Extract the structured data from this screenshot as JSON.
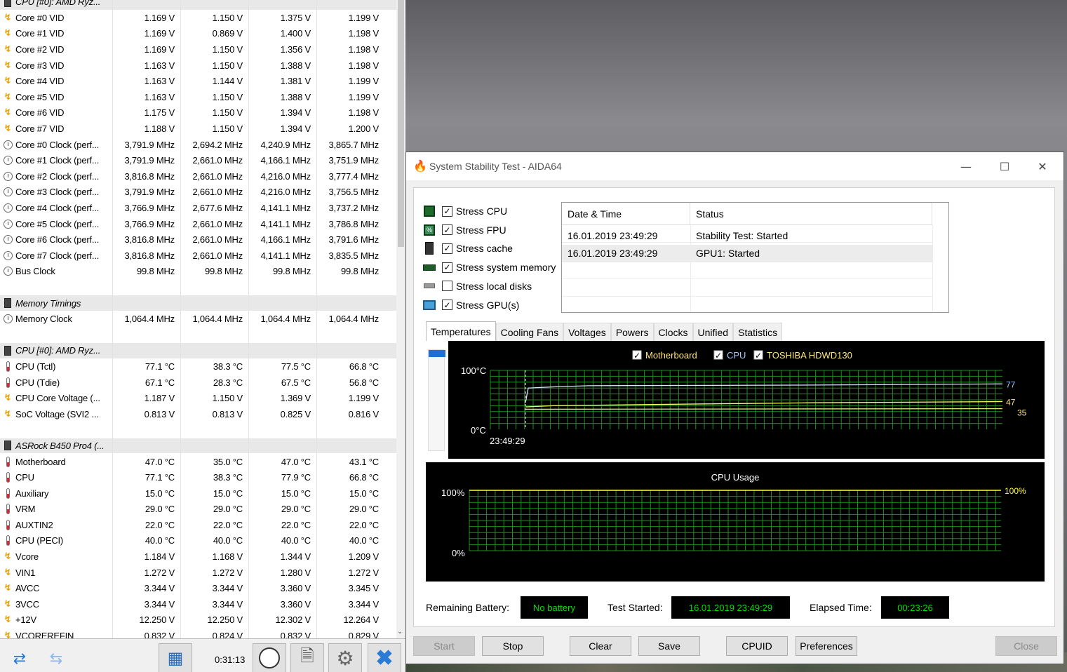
{
  "hwinfo": {
    "rows": [
      {
        "type": "group",
        "icon": "chip",
        "name": "CPU [#0]: AMD Ryz...",
        "v": [
          "",
          "",
          "",
          ""
        ]
      },
      {
        "type": "row",
        "icon": "bolt",
        "name": "Core #0 VID",
        "v": [
          "1.169 V",
          "1.150 V",
          "1.375 V",
          "1.199 V"
        ]
      },
      {
        "type": "row",
        "icon": "bolt",
        "name": "Core #1 VID",
        "v": [
          "1.169 V",
          "0.869 V",
          "1.400 V",
          "1.198 V"
        ]
      },
      {
        "type": "row",
        "icon": "bolt",
        "name": "Core #2 VID",
        "v": [
          "1.169 V",
          "1.150 V",
          "1.356 V",
          "1.198 V"
        ]
      },
      {
        "type": "row",
        "icon": "bolt",
        "name": "Core #3 VID",
        "v": [
          "1.163 V",
          "1.150 V",
          "1.388 V",
          "1.198 V"
        ]
      },
      {
        "type": "row",
        "icon": "bolt",
        "name": "Core #4 VID",
        "v": [
          "1.163 V",
          "1.144 V",
          "1.381 V",
          "1.199 V"
        ]
      },
      {
        "type": "row",
        "icon": "bolt",
        "name": "Core #5 VID",
        "v": [
          "1.163 V",
          "1.150 V",
          "1.388 V",
          "1.199 V"
        ]
      },
      {
        "type": "row",
        "icon": "bolt",
        "name": "Core #6 VID",
        "v": [
          "1.175 V",
          "1.150 V",
          "1.394 V",
          "1.198 V"
        ]
      },
      {
        "type": "row",
        "icon": "bolt",
        "name": "Core #7 VID",
        "v": [
          "1.188 V",
          "1.150 V",
          "1.394 V",
          "1.200 V"
        ]
      },
      {
        "type": "row",
        "icon": "clock",
        "name": "Core #0 Clock (perf...",
        "v": [
          "3,791.9 MHz",
          "2,694.2 MHz",
          "4,240.9 MHz",
          "3,865.7 MHz"
        ]
      },
      {
        "type": "row",
        "icon": "clock",
        "name": "Core #1 Clock (perf...",
        "v": [
          "3,791.9 MHz",
          "2,661.0 MHz",
          "4,166.1 MHz",
          "3,751.9 MHz"
        ]
      },
      {
        "type": "row",
        "icon": "clock",
        "name": "Core #2 Clock (perf...",
        "v": [
          "3,816.8 MHz",
          "2,661.0 MHz",
          "4,216.0 MHz",
          "3,777.4 MHz"
        ]
      },
      {
        "type": "row",
        "icon": "clock",
        "name": "Core #3 Clock (perf...",
        "v": [
          "3,791.9 MHz",
          "2,661.0 MHz",
          "4,216.0 MHz",
          "3,756.5 MHz"
        ]
      },
      {
        "type": "row",
        "icon": "clock",
        "name": "Core #4 Clock (perf...",
        "v": [
          "3,766.9 MHz",
          "2,677.6 MHz",
          "4,141.1 MHz",
          "3,737.2 MHz"
        ]
      },
      {
        "type": "row",
        "icon": "clock",
        "name": "Core #5 Clock (perf...",
        "v": [
          "3,766.9 MHz",
          "2,661.0 MHz",
          "4,141.1 MHz",
          "3,786.8 MHz"
        ]
      },
      {
        "type": "row",
        "icon": "clock",
        "name": "Core #6 Clock (perf...",
        "v": [
          "3,816.8 MHz",
          "2,661.0 MHz",
          "4,166.1 MHz",
          "3,791.6 MHz"
        ]
      },
      {
        "type": "row",
        "icon": "clock",
        "name": "Core #7 Clock (perf...",
        "v": [
          "3,816.8 MHz",
          "2,661.0 MHz",
          "4,141.1 MHz",
          "3,835.5 MHz"
        ]
      },
      {
        "type": "row",
        "icon": "clock",
        "name": "Bus Clock",
        "v": [
          "99.8 MHz",
          "99.8 MHz",
          "99.8 MHz",
          "99.8 MHz"
        ]
      },
      {
        "type": "blank",
        "icon": "",
        "name": "",
        "v": [
          "",
          "",
          "",
          ""
        ]
      },
      {
        "type": "group",
        "icon": "chip",
        "name": "Memory Timings",
        "v": [
          "",
          "",
          "",
          ""
        ]
      },
      {
        "type": "row",
        "icon": "clock",
        "name": "Memory Clock",
        "v": [
          "1,064.4 MHz",
          "1,064.4 MHz",
          "1,064.4 MHz",
          "1,064.4 MHz"
        ]
      },
      {
        "type": "blank",
        "icon": "",
        "name": "",
        "v": [
          "",
          "",
          "",
          ""
        ]
      },
      {
        "type": "group",
        "icon": "chip",
        "name": "CPU [#0]: AMD Ryz...",
        "v": [
          "",
          "",
          "",
          ""
        ]
      },
      {
        "type": "row",
        "icon": "therm",
        "name": "CPU (Tctl)",
        "v": [
          "77.1 °C",
          "38.3 °C",
          "77.5 °C",
          "66.8 °C"
        ]
      },
      {
        "type": "row",
        "icon": "therm",
        "name": "CPU (Tdie)",
        "v": [
          "67.1 °C",
          "28.3 °C",
          "67.5 °C",
          "56.8 °C"
        ]
      },
      {
        "type": "row",
        "icon": "bolt",
        "name": "CPU Core Voltage (...",
        "v": [
          "1.187 V",
          "1.150 V",
          "1.369 V",
          "1.199 V"
        ]
      },
      {
        "type": "row",
        "icon": "bolt",
        "name": "SoC Voltage (SVI2 ...",
        "v": [
          "0.813 V",
          "0.813 V",
          "0.825 V",
          "0.816 V"
        ]
      },
      {
        "type": "blank",
        "icon": "",
        "name": "",
        "v": [
          "",
          "",
          "",
          ""
        ]
      },
      {
        "type": "group",
        "icon": "chip",
        "name": "ASRock B450 Pro4 (...",
        "v": [
          "",
          "",
          "",
          ""
        ]
      },
      {
        "type": "row",
        "icon": "therm",
        "name": "Motherboard",
        "v": [
          "47.0 °C",
          "35.0 °C",
          "47.0 °C",
          "43.1 °C"
        ]
      },
      {
        "type": "row",
        "icon": "therm",
        "name": "CPU",
        "v": [
          "77.1 °C",
          "38.3 °C",
          "77.9 °C",
          "66.8 °C"
        ]
      },
      {
        "type": "row",
        "icon": "therm",
        "name": "Auxiliary",
        "v": [
          "15.0 °C",
          "15.0 °C",
          "15.0 °C",
          "15.0 °C"
        ]
      },
      {
        "type": "row",
        "icon": "therm",
        "name": "VRM",
        "v": [
          "29.0 °C",
          "29.0 °C",
          "29.0 °C",
          "29.0 °C"
        ]
      },
      {
        "type": "row",
        "icon": "therm",
        "name": "AUXTIN2",
        "v": [
          "22.0 °C",
          "22.0 °C",
          "22.0 °C",
          "22.0 °C"
        ]
      },
      {
        "type": "row",
        "icon": "therm",
        "name": "CPU (PECI)",
        "v": [
          "40.0 °C",
          "40.0 °C",
          "40.0 °C",
          "40.0 °C"
        ]
      },
      {
        "type": "row",
        "icon": "bolt",
        "name": "Vcore",
        "v": [
          "1.184 V",
          "1.168 V",
          "1.344 V",
          "1.209 V"
        ]
      },
      {
        "type": "row",
        "icon": "bolt",
        "name": "VIN1",
        "v": [
          "1.272 V",
          "1.272 V",
          "1.280 V",
          "1.272 V"
        ]
      },
      {
        "type": "row",
        "icon": "bolt",
        "name": "AVCC",
        "v": [
          "3.344 V",
          "3.344 V",
          "3.360 V",
          "3.345 V"
        ]
      },
      {
        "type": "row",
        "icon": "bolt",
        "name": "3VCC",
        "v": [
          "3.344 V",
          "3.344 V",
          "3.360 V",
          "3.344 V"
        ]
      },
      {
        "type": "row",
        "icon": "bolt",
        "name": "+12V",
        "v": [
          "12.250 V",
          "12.250 V",
          "12.302 V",
          "12.264 V"
        ]
      },
      {
        "type": "row",
        "icon": "bolt",
        "name": "VCOREREFIN",
        "v": [
          "0.832 V",
          "0.824 V",
          "0.832 V",
          "0.829 V"
        ]
      }
    ],
    "toolbar": {
      "timer": "0:31:13",
      "icons": [
        "nav-arrows-icon",
        "nav-arrows-disabled-icon",
        "network-icon",
        "clock-icon",
        "report-icon",
        "settings-icon",
        "close-x-icon"
      ]
    }
  },
  "aida": {
    "title": "System Stability Test - AIDA64",
    "stress_options": [
      {
        "label": "Stress CPU",
        "checked": true,
        "icon": "cpu-icon"
      },
      {
        "label": "Stress FPU",
        "checked": true,
        "icon": "fpu-icon"
      },
      {
        "label": "Stress cache",
        "checked": true,
        "icon": "cache-icon"
      },
      {
        "label": "Stress system memory",
        "checked": true,
        "icon": "memory-icon"
      },
      {
        "label": "Stress local disks",
        "checked": false,
        "icon": "disk-icon"
      },
      {
        "label": "Stress GPU(s)",
        "checked": true,
        "icon": "gpu-icon"
      }
    ],
    "log": {
      "headers": [
        "Date & Time",
        "Status"
      ],
      "rows": [
        {
          "time": "16.01.2019 23:49:29",
          "status": "Stability Test: Started"
        },
        {
          "time": "16.01.2019 23:49:29",
          "status": "GPU1: Started"
        }
      ]
    },
    "tabs": [
      "Temperatures",
      "Cooling Fans",
      "Voltages",
      "Powers",
      "Clocks",
      "Unified",
      "Statistics"
    ],
    "active_tab": "Temperatures",
    "temp_graph": {
      "legend": [
        {
          "label": "Motherboard",
          "checked": true,
          "color": "#ffe680"
        },
        {
          "label": "CPU",
          "checked": true,
          "color": "#a8c8ff"
        },
        {
          "label": "TOSHIBA HDWD130",
          "checked": true,
          "color": "#ffe680"
        }
      ],
      "y_max_label": "100°C",
      "y_min_label": "0°C",
      "x_label": "23:49:29",
      "end_values": [
        "77",
        "47",
        "35"
      ],
      "colors": {
        "grid": "#1f8f1f",
        "cpu": "#dce6ff",
        "motherboard": "#ffff66",
        "disk": "#e6e67a"
      }
    },
    "cpu_graph": {
      "title": "CPU Usage",
      "y_max_label": "100%",
      "y_min_label": "0%",
      "end_value": "100%",
      "color": "#ffff33"
    },
    "status": {
      "battery_label": "Remaining Battery:",
      "battery_value": "No battery",
      "started_label": "Test Started:",
      "started_value": "16.01.2019 23:49:29",
      "elapsed_label": "Elapsed Time:",
      "elapsed_value": "00:23:26"
    },
    "buttons": {
      "start": "Start",
      "stop": "Stop",
      "clear": "Clear",
      "save": "Save",
      "cpuid": "CPUID",
      "preferences": "Preferences",
      "close": "Close"
    }
  }
}
